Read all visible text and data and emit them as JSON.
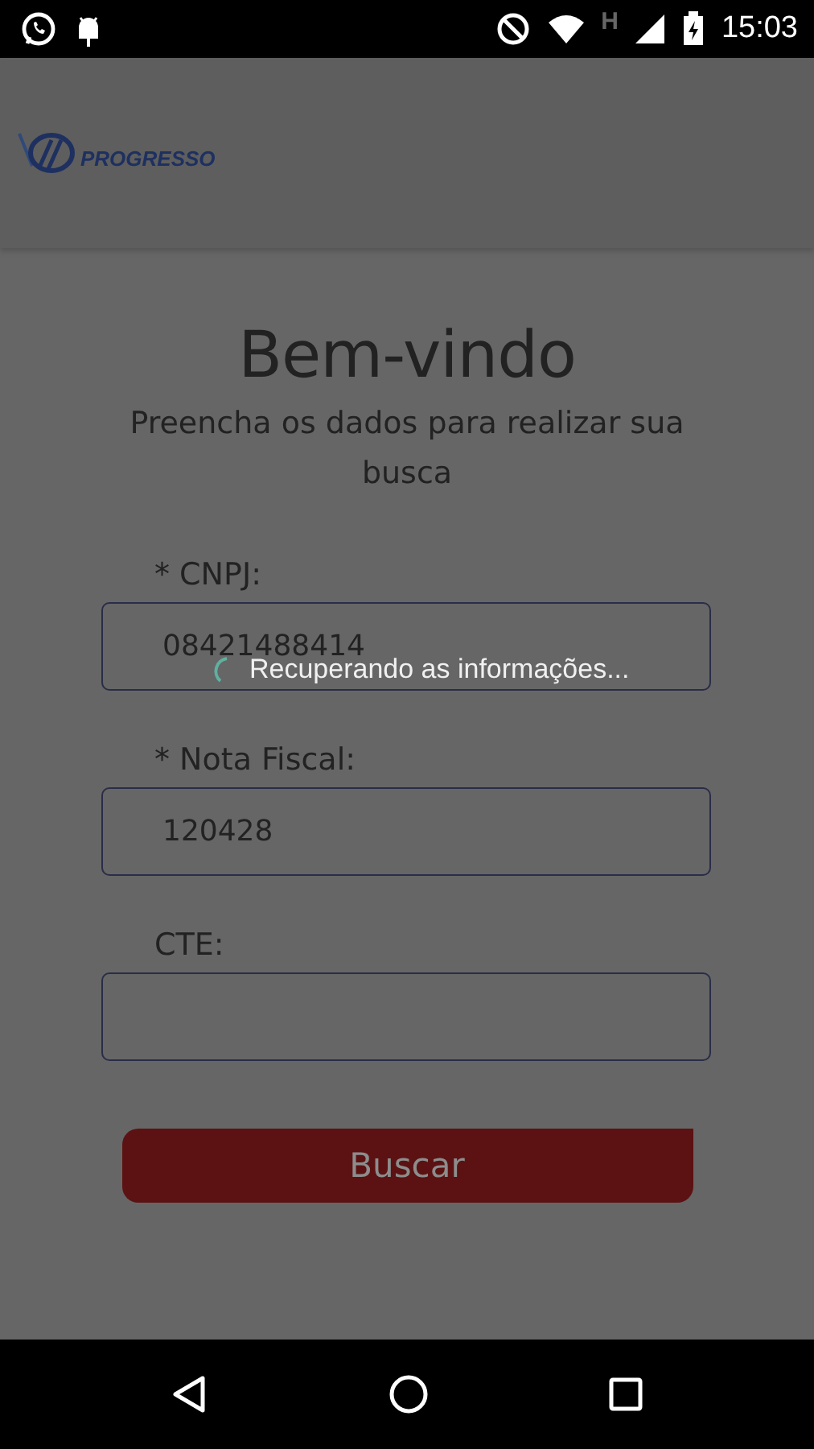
{
  "status_bar": {
    "network_type": "H",
    "time": "15:03"
  },
  "header": {
    "logo_text": "PROGRESSO"
  },
  "title": "Bem-vindo",
  "subtitle": "Preencha os dados para realizar sua busca",
  "fields": [
    {
      "label": "* CNPJ:",
      "value": "08421488414"
    },
    {
      "label": "* Nota Fiscal:",
      "value": "120428"
    },
    {
      "label": "CTE:"
    }
  ],
  "button": "Buscar",
  "loading": {
    "message": "Recuperando as informações..."
  }
}
